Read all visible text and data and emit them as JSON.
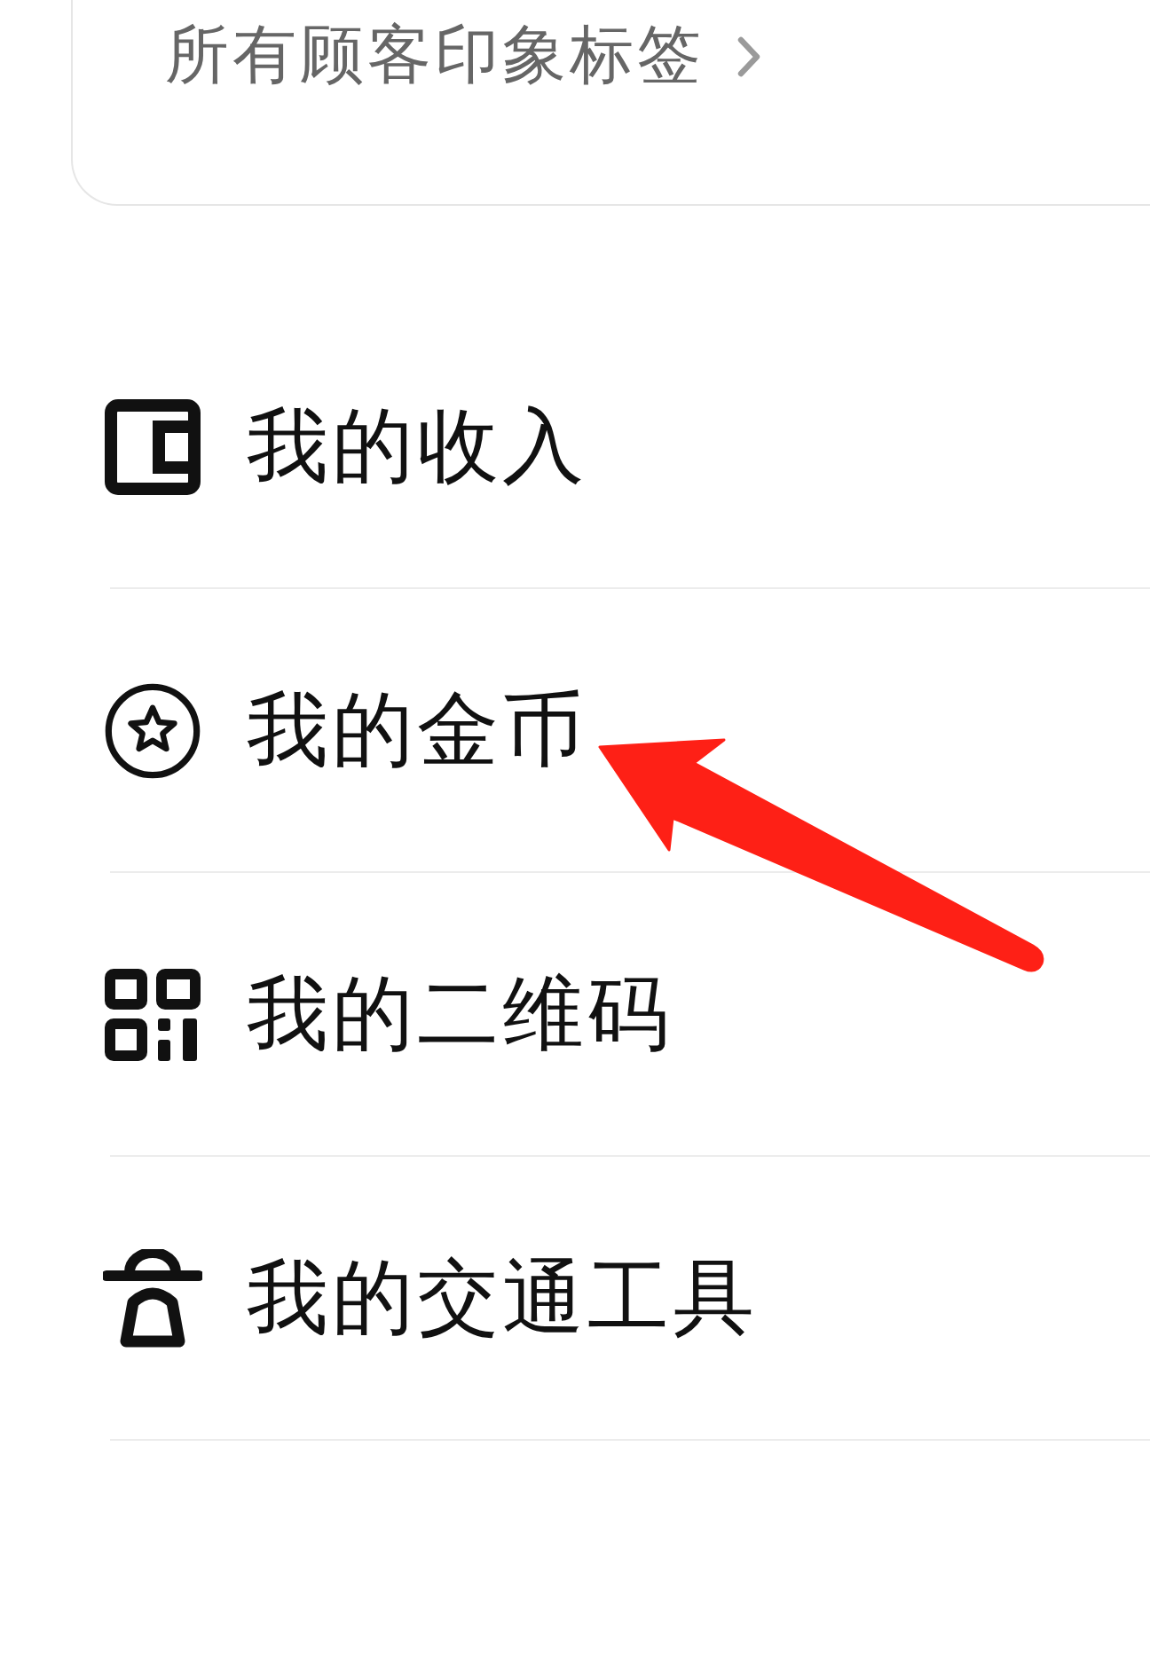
{
  "tags_link": {
    "label": "所有顾客印象标签"
  },
  "menu": [
    {
      "label": "我的收入",
      "marked": false
    },
    {
      "label": "我的金币",
      "marked": true
    },
    {
      "label": "我的二维码",
      "marked": false
    },
    {
      "label": "我的交通工具",
      "marked": false
    }
  ]
}
